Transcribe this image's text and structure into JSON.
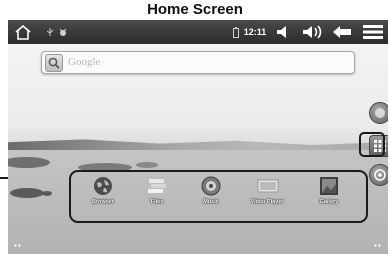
{
  "caption": "Home Screen",
  "status_bar": {
    "time": "12:11",
    "icons": [
      "home-icon",
      "usb-icon",
      "debug-icon",
      "battery-icon",
      "volume-down-icon",
      "volume-up-icon",
      "back-icon",
      "menu-icon"
    ]
  },
  "search": {
    "placeholder": "Google",
    "icon": "search-icon"
  },
  "side_buttons": [
    "widget-icon",
    "apps-grid-icon",
    "settings-icon"
  ],
  "dock": {
    "items": [
      {
        "label": "Browser",
        "icon": "globe-icon"
      },
      {
        "label": "Files",
        "icon": "files-icon"
      },
      {
        "label": "Music",
        "icon": "music-icon"
      },
      {
        "label": "Video Player",
        "icon": "video-player-icon"
      },
      {
        "label": "Gallery",
        "icon": "gallery-icon"
      }
    ]
  },
  "colors": {
    "status_bar": "#2b2b2b",
    "callout_border": "#1a1a1a"
  }
}
